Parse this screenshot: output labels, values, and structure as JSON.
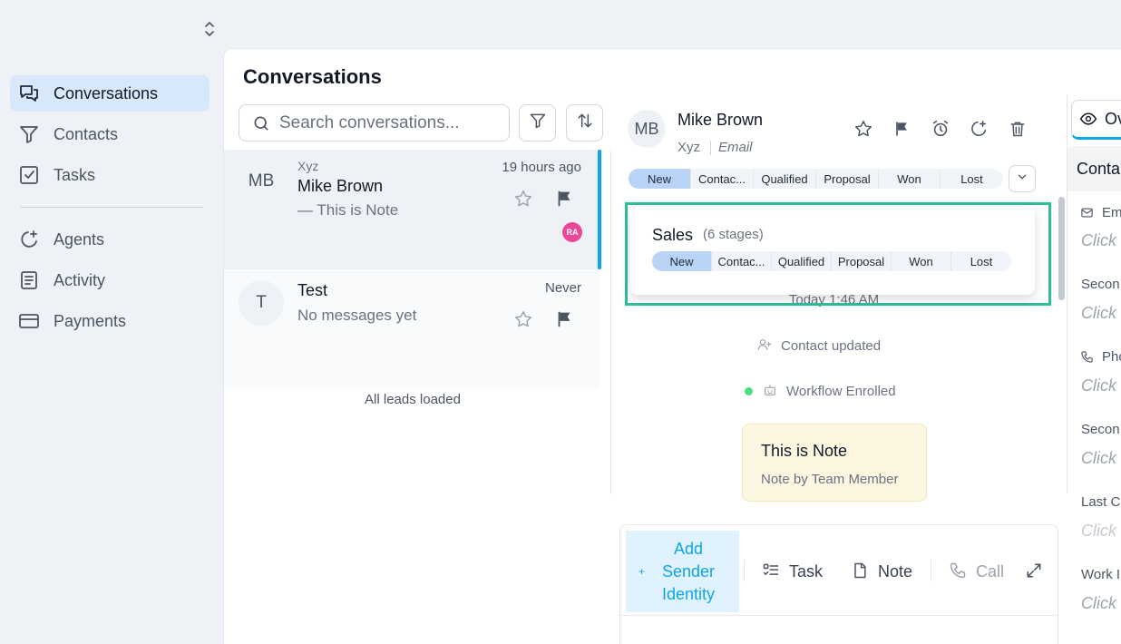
{
  "sidebar": {
    "items": [
      {
        "label": "Conversations",
        "icon": "chat-bubbles-icon",
        "active": true
      },
      {
        "label": "Contacts",
        "icon": "filter-funnel-icon"
      },
      {
        "label": "Tasks",
        "icon": "checkbox-icon"
      },
      {
        "label": "Agents",
        "icon": "sparkle-icon"
      },
      {
        "label": "Activity",
        "icon": "activity-list-icon"
      },
      {
        "label": "Payments",
        "icon": "credit-card-icon"
      }
    ]
  },
  "conversations": {
    "title": "Conversations",
    "search_placeholder": "Search conversations...",
    "items": [
      {
        "initials": "MB",
        "company": "Xyz",
        "name": "Mike Brown",
        "preview": "— This is Note",
        "time": "19 hours ago",
        "badge": "RA"
      },
      {
        "initials": "T",
        "name": "Test",
        "preview": "No messages yet",
        "time": "Never"
      }
    ],
    "footer": "All leads loaded"
  },
  "detail": {
    "initials": "MB",
    "name": "Mike Brown",
    "company": "Xyz",
    "email_label": "Email",
    "stages": [
      "New",
      "Contac...",
      "Qualified",
      "Proposal",
      "Won",
      "Lost"
    ],
    "current_stage": "New",
    "popover": {
      "title": "Sales",
      "count": "(6 stages)",
      "stages": [
        "New",
        "Contac...",
        "Qualified",
        "Proposal",
        "Won",
        "Lost"
      ]
    },
    "timeline": {
      "date": "Today 1:46 AM",
      "events": [
        "Contact updated",
        "Workflow Enrolled"
      ]
    },
    "note": {
      "title": "This is Note",
      "by": "Note by Team Member"
    }
  },
  "composer": {
    "sender": "Add Sender Identity",
    "tabs": [
      "Task",
      "Note",
      "Call"
    ]
  },
  "right_panel": {
    "tab": "Ov",
    "section": "Conta",
    "fields": [
      {
        "label": "Em",
        "value": "Click"
      },
      {
        "label": "Secon",
        "value": "Click"
      },
      {
        "label": "Pho",
        "value": "Click"
      },
      {
        "label": "Secon",
        "value": "Click"
      },
      {
        "label": "Last C",
        "value": "Click"
      },
      {
        "label": "Work I",
        "value": "Click"
      }
    ]
  },
  "colors": {
    "accent": "#0ea5e9",
    "active_nav": "#d7e8fb",
    "stage_current": "#b9d3f7",
    "highlight": "#2bbf9a",
    "badge": "#ec4899",
    "note_bg": "#fdf6e0"
  }
}
